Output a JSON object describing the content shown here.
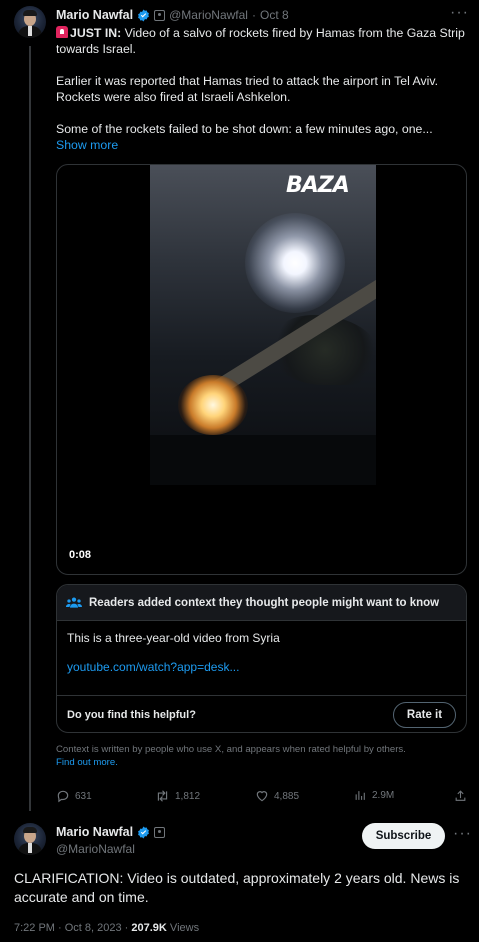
{
  "tweet": {
    "author_name": "Mario Nawfal",
    "handle": "@MarioNawfal",
    "separator": "·",
    "date": "Oct 8",
    "headline_prefix": "JUST IN:",
    "headline_rest": " Video of a salvo of rockets fired by Hamas from the Gaza Strip towards Israel.",
    "paragraph_2": "Earlier it was reported that Hamas tried to attack the airport in Tel Aviv. Rockets were also fired at Israeli Ashkelon.",
    "paragraph_3": "Some of the rockets failed to be shot down: a few minutes ago, one...",
    "show_more": "Show more",
    "more_menu": "···",
    "icons": {
      "siren": "siren-emoji-icon",
      "verified": "verified-badge-icon",
      "affiliate": "affiliate-badge-icon"
    },
    "accent_color": "#1d9bf0"
  },
  "media": {
    "watermark": "BAZA",
    "duration": "0:08"
  },
  "community_note": {
    "header": "Readers added context they thought people might want to know",
    "body": "This is a three-year-old video from Syria",
    "link": "youtube.com/watch?app=desk...",
    "question": "Do you find this helpful?",
    "rate_button": "Rate it",
    "disclaimer": "Context is written by people who use X, and appears when rated helpful by others.",
    "find_out_more": "Find out more."
  },
  "actions": {
    "replies": "631",
    "reposts": "1,812",
    "likes": "4,885",
    "views": "2.9M"
  },
  "reply": {
    "author_name": "Mario Nawfal",
    "handle": "@MarioNawfal",
    "subscribe_label": "Subscribe",
    "more_menu": "···",
    "text": "CLARIFICATION: Video is outdated, approximately 2 years old. News is accurate and on time.",
    "timestamp": "7:22 PM · Oct 8, 2023 · ",
    "views_count": "207.9K",
    "views_label": " Views"
  }
}
